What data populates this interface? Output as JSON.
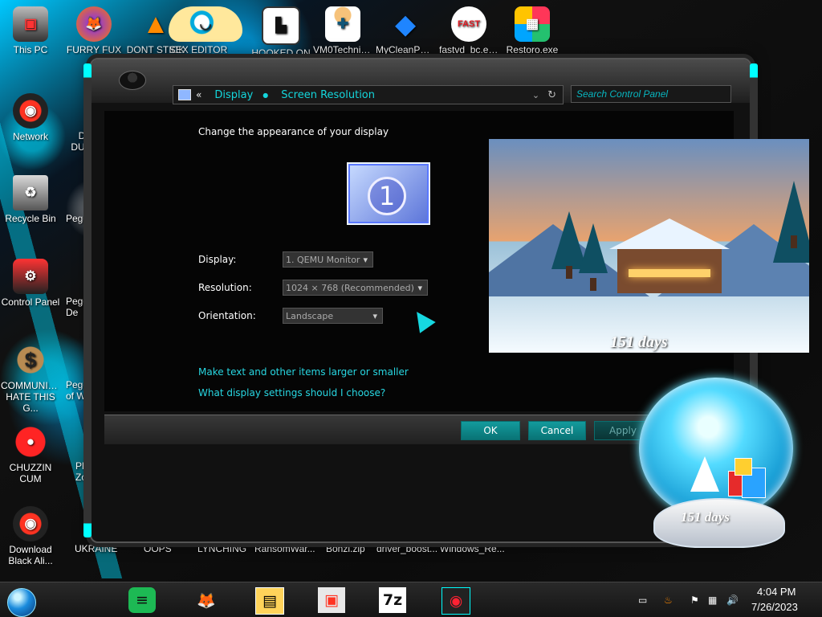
{
  "desktop_icons_top": [
    {
      "label": "This PC",
      "icon": "this-pc-icon"
    },
    {
      "label": "FURRY FUX",
      "icon": "firefox-icon"
    },
    {
      "label": "DONT STICK",
      "icon": "vlc-icon"
    },
    {
      "label": "SEX EDITOR",
      "icon": "cartoon-face-icon"
    },
    {
      "label": "HOOKED ON",
      "icon": "pixel-shortcut-icon"
    },
    {
      "label": "VM0Technic...",
      "icon": "doctor-icon"
    },
    {
      "label": "MyCleanPCIn...",
      "icon": "shield-icon"
    },
    {
      "label": "fastvd_bc.exe",
      "icon": "fast-video-downloader-icon"
    },
    {
      "label": "Restoro.exe",
      "icon": "restoro-icon"
    }
  ],
  "desktop_icons_left": [
    {
      "label": "Network",
      "icon": "network-icon"
    },
    {
      "label": "D DUM",
      "icon": "partial-icon"
    },
    {
      "label": "Recycle Bin",
      "icon": "recycle-bin-icon"
    },
    {
      "label": "Peggle",
      "icon": "peggle-icon"
    },
    {
      "label": "Control Panel",
      "icon": "control-panel-icon"
    },
    {
      "label": "Peggle De",
      "icon": "peggle-deluxe-icon"
    },
    {
      "label": "COMMUNISTS HATE THIS G...",
      "icon": "money-bag-icon"
    },
    {
      "label": "Peggle of Wa",
      "icon": "peggle-of-war-icon"
    },
    {
      "label": "CHUZZIN CUM",
      "icon": "red-creature-icon"
    },
    {
      "label": "Plan Zo",
      "icon": "plants-icon"
    },
    {
      "label": "Download Black Ali...",
      "icon": "alien-download-icon"
    },
    {
      "label": "UKRAINE",
      "icon": "gift-icon"
    }
  ],
  "desktop_bottom_labels": [
    "OOPS",
    "LYNCHING",
    "RansomWar...",
    "Bonzi.zip",
    "driver_boost...",
    "Windows_Re..."
  ],
  "window": {
    "address": {
      "back_forward": "«",
      "path": [
        "Display",
        "Screen Resolution"
      ],
      "search_placeholder": "Search Control Panel"
    },
    "heading": "Change the appearance of your display",
    "monitor_number": "1",
    "settings": {
      "display_label": "Display:",
      "display_value": "1. QEMU Monitor",
      "resolution_label": "Resolution:",
      "resolution_value": "1024 × 768 (Recommended)",
      "orientation_label": "Orientation:",
      "orientation_value": "Landscape"
    },
    "links": {
      "text_size": "Make text and other items larger or smaller",
      "display_settings_help": "What display settings should I choose?"
    },
    "buttons": {
      "ok": "OK",
      "cancel": "Cancel",
      "apply": "Apply"
    }
  },
  "widgets": {
    "photo_text": "151 days",
    "globe_text": "151 days"
  },
  "taskbar": {
    "time": "4:04 PM",
    "date": "7/26/2023"
  },
  "colors": {
    "accent": "#14d6dc",
    "link": "#28d7e2",
    "button": "#139b9d"
  }
}
